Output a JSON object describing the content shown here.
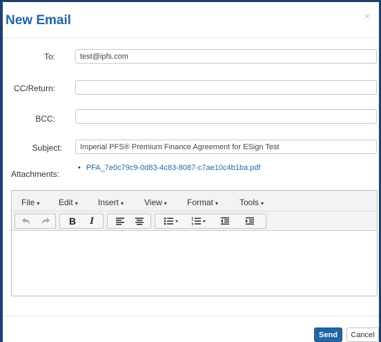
{
  "dialog": {
    "title": "New Email",
    "close_glyph": "×"
  },
  "form": {
    "to_label": "To:",
    "to_value": "test@ipfs.com",
    "cc_label": "CC/Return:",
    "cc_value": "",
    "bcc_label": "BCC:",
    "bcc_value": "",
    "subject_label": "Subject:",
    "subject_value": "Imperial PFS® Premium Finance Agreement for ESign Test",
    "attachments_label": "Attachments:",
    "attachments": [
      {
        "bullet": "•",
        "name": "PFA_7e0c79c9-0d83-4c83-8087-c7ae10c4b1ba.pdf"
      }
    ]
  },
  "editor": {
    "menus": [
      {
        "label": "File"
      },
      {
        "label": "Edit"
      },
      {
        "label": "Insert"
      },
      {
        "label": "View"
      },
      {
        "label": "Format"
      },
      {
        "label": "Tools"
      }
    ],
    "caret": "▾",
    "toolbar": {
      "undo_icon": "undo-icon",
      "redo_icon": "redo-icon",
      "bold_label": "B",
      "italic_label": "I",
      "align_left_icon": "align-left-icon",
      "align_center_icon": "align-center-icon",
      "bullet_list_icon": "bullet-list-icon",
      "numbered_list_icon": "numbered-list-icon",
      "outdent_icon": "outdent-icon",
      "indent_icon": "indent-icon"
    },
    "content": ""
  },
  "footer": {
    "send_label": "Send",
    "cancel_label": "Cancel"
  },
  "colors": {
    "brand": "#1f66a6",
    "frame": "#1d3f72"
  }
}
